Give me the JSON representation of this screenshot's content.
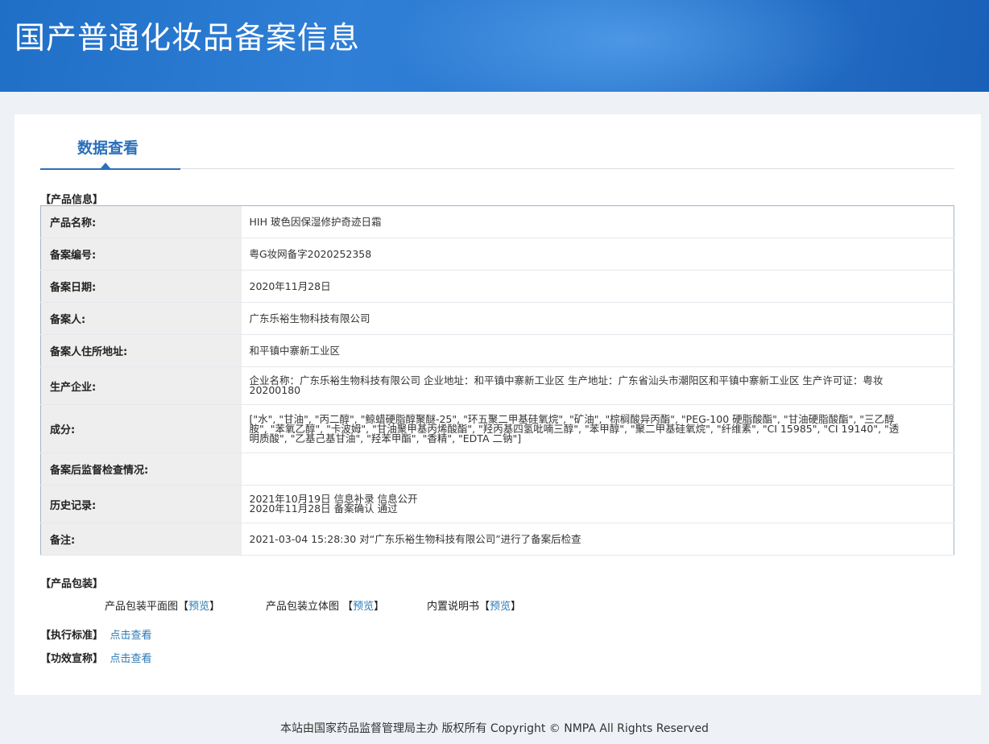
{
  "header": {
    "title": "国产普通化妆品备案信息"
  },
  "tab": {
    "label": "数据查看"
  },
  "product_info": {
    "heading": "【产品信息】",
    "rows": [
      {
        "label": "产品名称:",
        "value": "HIH 玻色因保湿修护奇迹日霜"
      },
      {
        "label": "备案编号:",
        "value": "粤G妆网备字2020252358"
      },
      {
        "label": "备案日期:",
        "value": "2020年11月28日"
      },
      {
        "label": "备案人:",
        "value": "广东乐裕生物科技有限公司"
      },
      {
        "label": "备案人住所地址:",
        "value": "和平镇中寨新工业区"
      },
      {
        "label": "生产企业:",
        "value": "企业名称：广东乐裕生物科技有限公司 企业地址：和平镇中寨新工业区 生产地址：广东省汕头市潮阳区和平镇中寨新工业区 生产许可证：粤妆20200180"
      },
      {
        "label": "成分:",
        "value": "[\"水\", \"甘油\", \"丙二醇\", \"鲸蜡硬脂醇聚醚-25\", \"环五聚二甲基硅氧烷\", \"矿油\", \"棕榈酸异丙酯\", \"PEG-100 硬脂酸酯\", \"甘油硬脂酸酯\", \"三乙醇胺\", \"苯氧乙醇\", \"卡波姆\", \"甘油聚甲基丙烯酸酯\", \"羟丙基四氢吡喃三醇\", \"苯甲醇\", \"聚二甲基硅氧烷\", \"纤维素\", \"CI 15985\", \"CI 19140\", \"透明质酸\", \"乙基己基甘油\", \"羟苯甲酯\", \"香精\", \"EDTA 二钠\"]"
      },
      {
        "label": "备案后监督检查情况:",
        "value": ""
      },
      {
        "label": "历史记录:",
        "value": "2021年10月19日 信息补录 信息公开\n2020年11月28日 备案确认 通过"
      },
      {
        "label": "备注:",
        "value": "2021-03-04 15:28:30 对“广东乐裕生物科技有限公司”进行了备案后检查"
      }
    ]
  },
  "packaging": {
    "heading": "【产品包装】",
    "items": [
      {
        "label": "产品包装平面图【",
        "link": "预览",
        "close": "】"
      },
      {
        "label": "产品包装立体图 【",
        "link": "预览",
        "close": "】"
      },
      {
        "label": "内置说明书【",
        "link": "预览",
        "close": "】"
      }
    ]
  },
  "standard": {
    "heading": "【执行标准】",
    "link": "点击查看"
  },
  "efficacy": {
    "heading": "【功效宣称】",
    "link": "点击查看"
  },
  "footer": {
    "text": "本站由国家药品监督管理局主办 版权所有 Copyright © NMPA All Rights Reserved"
  }
}
